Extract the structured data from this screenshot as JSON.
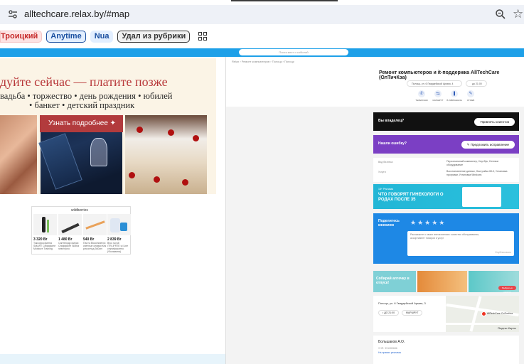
{
  "browser": {
    "url": "alltechcare.relax.by/#map"
  },
  "chips": {
    "items": [
      "Троицкий",
      "Anytime",
      "Nua",
      "Удал из рубрики"
    ]
  },
  "search": {
    "placeholder": "Поиск мест и событий"
  },
  "left": {
    "banner_title": "дуйте сейчас — платите позже",
    "banner_line1": "вадьба • торжество • день рождения • юбилей",
    "banner_line2": "• банкет • детский праздник",
    "more_button": "Узнать подробнее ✦",
    "ad_logo": "wildberries",
    "ad_items": [
      {
        "price": "3 320 Br",
        "desc": "Токсофосфатна SMART Сниффиле Moisture Training"
      },
      {
        "price": "1 480 Br",
        "desc": "Сантехидр мирах Сниффиле Slutha электрого"
      },
      {
        "price": "540 Br",
        "desc": "Пасть Bloodnoterdo светлые оливки Кек рисоплод 360мл"
      },
      {
        "price": "2 839 Br",
        "desc": "Brco scrub ITRLIFRTE ut Line сертификатно (Фоламина)"
      }
    ]
  },
  "right": {
    "breadcrumb": "Relax › Ремонт компьютеров › Полоцк › Полоцк",
    "title": "Ремонт компьютеров и it-поддержка AllTechCare (ОлТичКэа)",
    "address": "Полоцк, ул. 6 Гвардейской Армии, 4",
    "hours": "до 21:00",
    "actions": [
      "ТЕЛЕФОНЫ",
      "МАРШРУТ",
      "В ИЗБРАННОЕ",
      "ОТЗЫВ"
    ],
    "black_card": {
      "label": "Вы владелец?",
      "button": "Привлечь клиентов"
    },
    "purple_card": {
      "label": "Нашли ошибку?",
      "button": "Предложить исправление"
    },
    "info": [
      {
        "key": "Вид бизнеса",
        "value": "Персональный компьютер, Ноутбук, Сетевое оборудование"
      },
      {
        "key": "Услуги",
        "value": "Восстановление данных, Настройка Wi-fi, Установка программ, Установка Windows"
      }
    ],
    "promo": {
      "ad": "18+  Реклама",
      "text": "ЧТО ГОВОРЯТ ГИНЕКОЛОГИ О РОДАХ ПОСЛЕ 35"
    },
    "rate": {
      "label": "Поделитесь мнением",
      "placeholder": "Расскажите о своих впечатлениях: качество обслуживания, ассортимент товаров и услуг",
      "publish": "Опубликовать"
    },
    "tile_a": "Собирай аптечку в отпуск!",
    "tile_c_btn": "Выбрать в каталог",
    "map": {
      "address": "Полоцк, ул. 6 Гвардейской Армии, 3",
      "hours_btn": "• ДО 21:00",
      "route_btn": "МАРШРУТ",
      "pin_label": "AllTechCare ОлТичКэа",
      "brand": "Яндекс Карты"
    },
    "person": {
      "name": "Большаков А.О.",
      "meta": "УНП: 391283686",
      "link": "На правах рекламы"
    }
  }
}
